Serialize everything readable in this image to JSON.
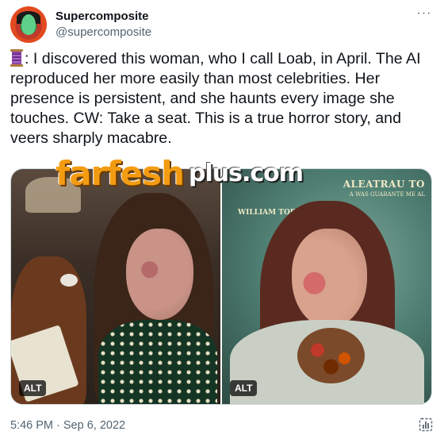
{
  "user": {
    "name": "Supercomposite",
    "handle": "@supercomposite"
  },
  "tweet": {
    "text": ": I discovered this woman, who I call Loab, in April. The AI reproduced her more easily than most celebrities. Her presence is persistent, and she haunts every image she touches. CW: Take a seat. This is a true horror story, and veers sharply macabre.",
    "leading_icon": "thread-spool-icon"
  },
  "media": {
    "photos": [
      {
        "alt_label": "ALT"
      },
      {
        "alt_label": "ALT",
        "painted_text": "WILLIAM TORRANCE",
        "painted_title": "ALEATRAU TO",
        "painted_sub": "A WAS GUARANTE ME AL"
      }
    ]
  },
  "watermark": {
    "part1": "farfesh",
    "part2": "plus.com"
  },
  "footer": {
    "timestamp": "5:46 PM · Sep 6, 2022",
    "stats_icon": "analytics-icon"
  },
  "colors": {
    "text_primary": "#0f1419",
    "text_secondary": "#536471",
    "border": "#cfd9de",
    "watermark_orange": "#f39c12"
  }
}
